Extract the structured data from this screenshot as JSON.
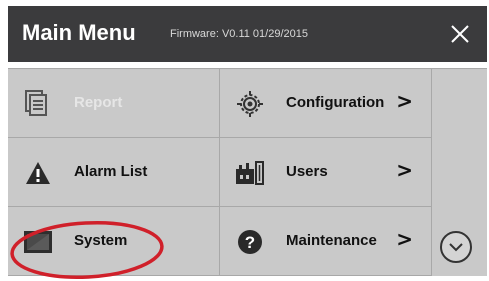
{
  "header": {
    "title": "Main Menu",
    "firmware": "Firmware: V0.11 01/29/2015",
    "close_glyph": "✕"
  },
  "menu": {
    "items": [
      {
        "label": "Report",
        "icon": "report-icon",
        "enabled": false,
        "has_submenu": false
      },
      {
        "label": "Configuration",
        "icon": "gear-icon",
        "enabled": true,
        "has_submenu": true
      },
      {
        "label": "Alarm List",
        "icon": "warning-icon",
        "enabled": true,
        "has_submenu": false
      },
      {
        "label": "Users",
        "icon": "factory-icon",
        "enabled": true,
        "has_submenu": true
      },
      {
        "label": "System",
        "icon": "monitor-icon",
        "enabled": true,
        "has_submenu": false
      },
      {
        "label": "Maintenance",
        "icon": "help-icon",
        "enabled": true,
        "has_submenu": true
      }
    ],
    "chevron": ">"
  },
  "colors": {
    "header_bg": "#3b3b3d",
    "grid_bg": "#c9c9c9",
    "annotation": "#d0202a"
  }
}
